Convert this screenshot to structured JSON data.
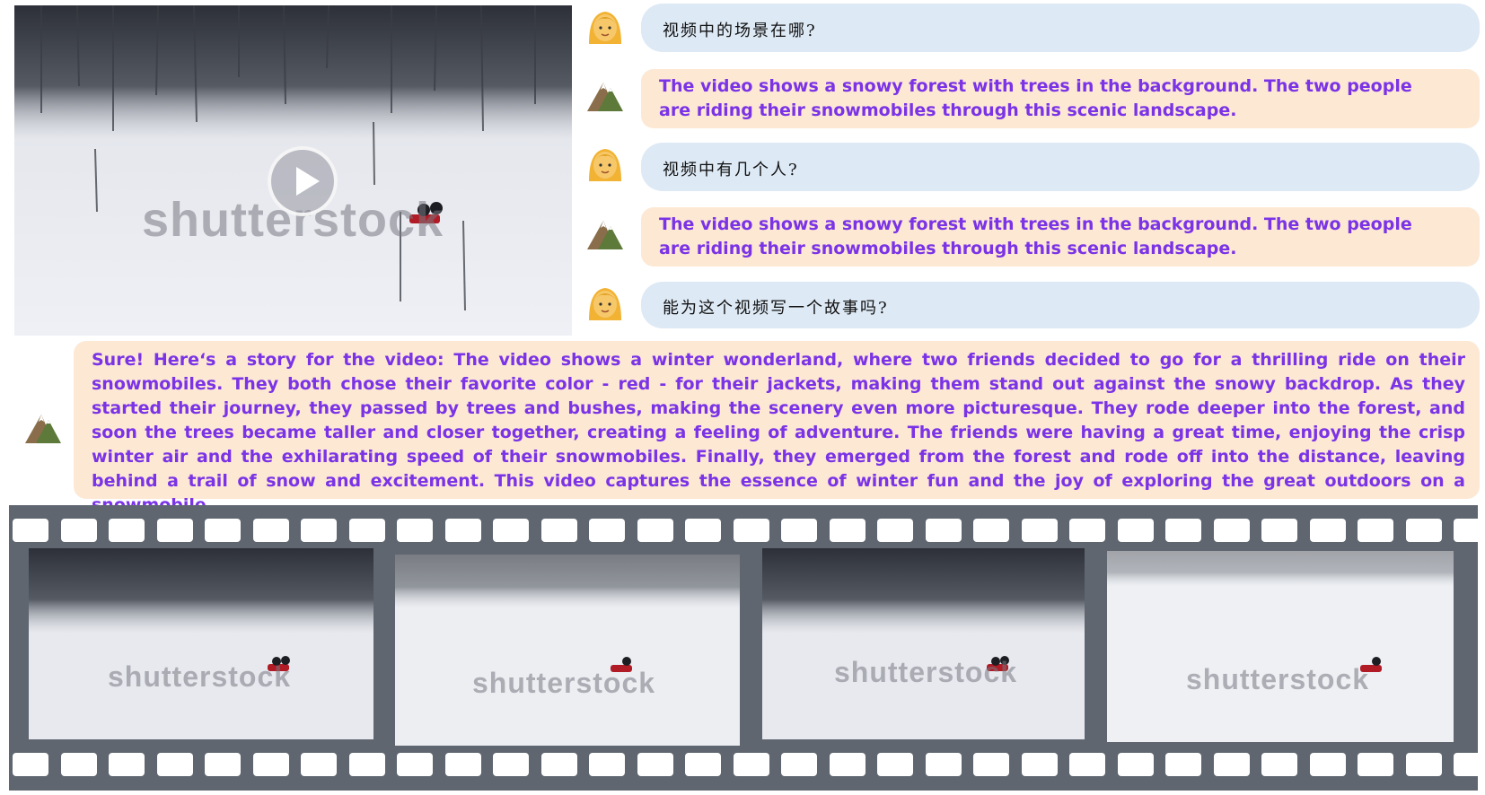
{
  "video": {
    "watermark": "shutterstock",
    "play_icon": "play-icon"
  },
  "chat": [
    {
      "role": "user",
      "avatar": "woman-avatar-icon",
      "text": "视频中的场景在哪?"
    },
    {
      "role": "assistant",
      "avatar": "mountain-avatar-icon",
      "text": "The video shows a snowy forest with trees in the background. The two people are riding their snowmobiles through this scenic landscape."
    },
    {
      "role": "user",
      "avatar": "woman-avatar-icon",
      "text": "视频中有几个人?"
    },
    {
      "role": "assistant",
      "avatar": "mountain-avatar-icon",
      "text": "The video shows a snowy forest with trees in the background. The two people are riding their snowmobiles through this scenic landscape."
    },
    {
      "role": "user",
      "avatar": "woman-avatar-icon",
      "text": "能为这个视频写一个故事吗?"
    },
    {
      "role": "assistant",
      "avatar": "mountain-avatar-icon",
      "text": "Sure! Here‘s a story for the video: The video shows a winter wonderland, where two friends decided to go for a thrilling ride on their snowmobiles. They both chose their favorite color - red - for their jackets, making them stand out against the snowy backdrop. As they started their journey, they passed by trees and bushes, making the scenery even more picturesque. They rode deeper into the forest, and soon the trees became taller and closer together, creating a feeling of adventure. The friends were having a great time, enjoying the crisp winter air and the exhilarating speed of their snowmobiles. Finally, they emerged from the forest and rode off into the distance, leaving behind a trail of snow and excitement. This video captures the essence of winter fun and the joy of exploring the great outdoors on a snowmobile."
    }
  ],
  "frames": [
    {
      "watermark": "shutterstock"
    },
    {
      "watermark": "shutterstock"
    },
    {
      "watermark": "shutterstock"
    },
    {
      "watermark": "shutterstock"
    }
  ],
  "colors": {
    "user_bubble": "#dde9f5",
    "assistant_bubble": "#fde8d3",
    "assistant_text": "#7a33e6",
    "film": "#5f6670"
  }
}
